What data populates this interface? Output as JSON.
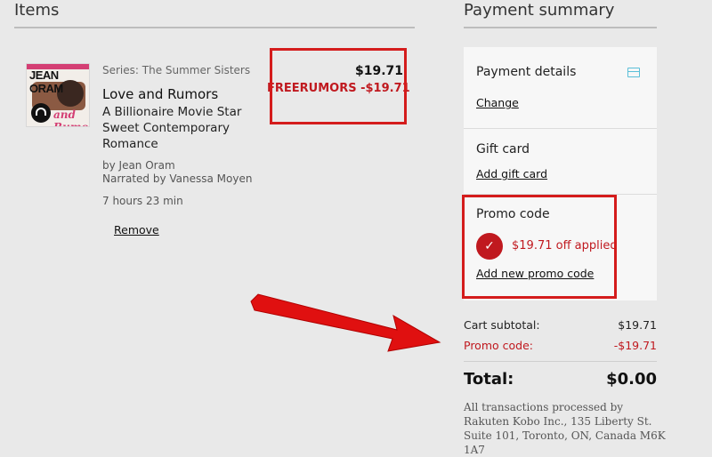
{
  "headers": {
    "items": "Items",
    "payment_summary": "Payment summary"
  },
  "item": {
    "cover": {
      "author": "JEAN ORAM",
      "title": "and Rumors"
    },
    "series": "Series: The Summer Sisters",
    "title": "Love and Rumors",
    "subtitle": "A Billionaire Movie Star Sweet Contemporary Romance",
    "author": "by Jean Oram",
    "narrator": "Narrated by Vanessa Moyen",
    "duration": "7 hours 23 min",
    "remove_label": "Remove",
    "price": "$19.71",
    "promo_line": "FREERUMORS -$19.71"
  },
  "payment": {
    "details_label": "Payment details",
    "details_icon": "credit-card-icon",
    "change_label": "Change",
    "gift_card_label": "Gift card",
    "add_gift_card_label": "Add gift card",
    "promo_code_label": "Promo code",
    "check_icon": "check-icon",
    "applied_text": "$19.71 off applied",
    "add_promo_label": "Add new promo code"
  },
  "totals": {
    "subtotal_label": "Cart subtotal:",
    "subtotal_value": "$19.71",
    "promo_label": "Promo code:",
    "promo_value": "-$19.71",
    "total_label": "Total:",
    "total_value": "$0.00"
  },
  "fineprint": "All transactions processed by Rakuten Kobo Inc., 135 Liberty St. Suite 101, Toronto, ON, Canada M6K 1A7",
  "colors": {
    "highlight": "#d41c1c",
    "promo_red": "#c0191f",
    "arrow": "#e01010",
    "card_icon": "#5bbfd8"
  }
}
